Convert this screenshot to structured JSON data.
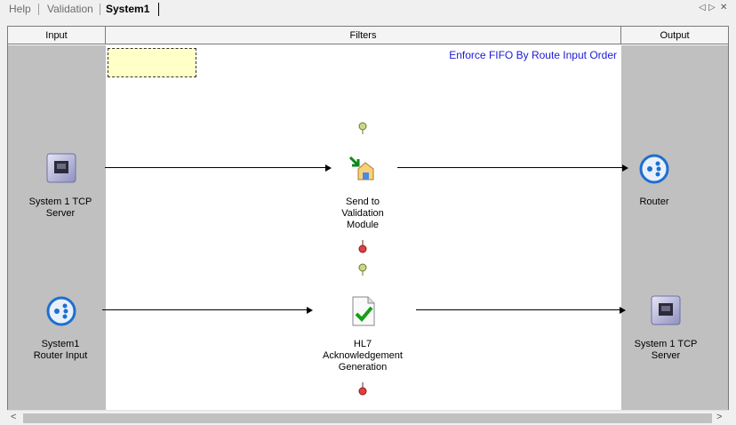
{
  "tabs": [
    {
      "label": "Help",
      "active": false
    },
    {
      "label": "Validation",
      "active": false
    },
    {
      "label": "System1",
      "active": true
    }
  ],
  "nav": {
    "prev": "◁",
    "next": "▷",
    "close": "✕"
  },
  "columns": {
    "input": "Input",
    "filters": "Filters",
    "output": "Output"
  },
  "note_text": "",
  "enforce_label": "Enforce FIFO By Route Input Order",
  "inputs": [
    {
      "label_line1": "System 1 TCP",
      "label_line2": "Server",
      "icon": "tcp-server-icon"
    },
    {
      "label_line1": "System1",
      "label_line2": "Router Input",
      "icon": "router-icon"
    }
  ],
  "filters": [
    {
      "label_line1": "Send to",
      "label_line2": "Validation",
      "label_line3": "Module",
      "icon": "send-to-module-icon"
    },
    {
      "label_line1": "HL7",
      "label_line2": "Acknowledgement",
      "label_line3": "Generation",
      "icon": "document-check-icon"
    }
  ],
  "outputs": [
    {
      "label_line1": "Router",
      "label_line2": "",
      "icon": "router-icon"
    },
    {
      "label_line1": "System 1 TCP",
      "label_line2": "Server",
      "icon": "tcp-server-icon"
    }
  ],
  "scrollbar": {
    "left": "<",
    "right": ">"
  },
  "colors": {
    "panel": "#c0c0c0",
    "note": "#ffffc8",
    "link": "#1a1ad6",
    "accent_blue": "#1e6fd0"
  }
}
